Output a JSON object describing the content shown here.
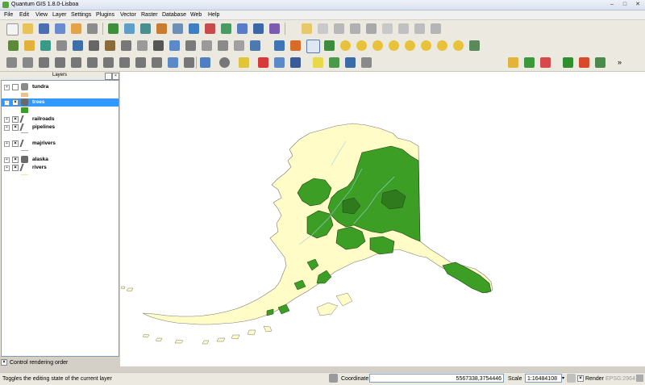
{
  "window": {
    "title": "Quantum GIS 1.8.0-Lisboa"
  },
  "menu": [
    "File",
    "Edit",
    "View",
    "Layer",
    "Settings",
    "Plugins",
    "Vector",
    "Raster",
    "Database",
    "Web",
    "Help"
  ],
  "layers_panel": {
    "title": "Layers",
    "layers": [
      {
        "name": "tundra",
        "visible": false,
        "icon": "polygon-layer-icon",
        "selected": false
      },
      {
        "name": "trees",
        "visible": true,
        "icon": "polygon-layer-icon",
        "selected": true
      },
      {
        "name": "railroads",
        "visible": true,
        "icon": "line-layer-icon",
        "selected": false
      },
      {
        "name": "pipelines",
        "visible": true,
        "icon": "line-layer-icon",
        "selected": false
      },
      {
        "name": "majrivers",
        "visible": true,
        "icon": "line-layer-icon",
        "selected": false
      },
      {
        "name": "alaska",
        "visible": true,
        "icon": "polygon-layer-icon",
        "selected": false
      },
      {
        "name": "rivers",
        "visible": true,
        "icon": "line-layer-icon",
        "selected": false
      }
    ],
    "control_rendering_order": "Control rendering order",
    "control_rendering_checked": true
  },
  "status": {
    "message": "Toggles the editing state of the current layer",
    "coordinate_label": "Coordinate:",
    "coordinate_value": "5567338,3754446",
    "scale_label": "Scale",
    "scale_value": "1:16484108",
    "render_label": "Render",
    "render_checked": true,
    "crs": "EPSG:2964"
  },
  "colors": {
    "land": "#fffcc7",
    "trees": "#3d9e26",
    "selection": "#3399ff"
  }
}
